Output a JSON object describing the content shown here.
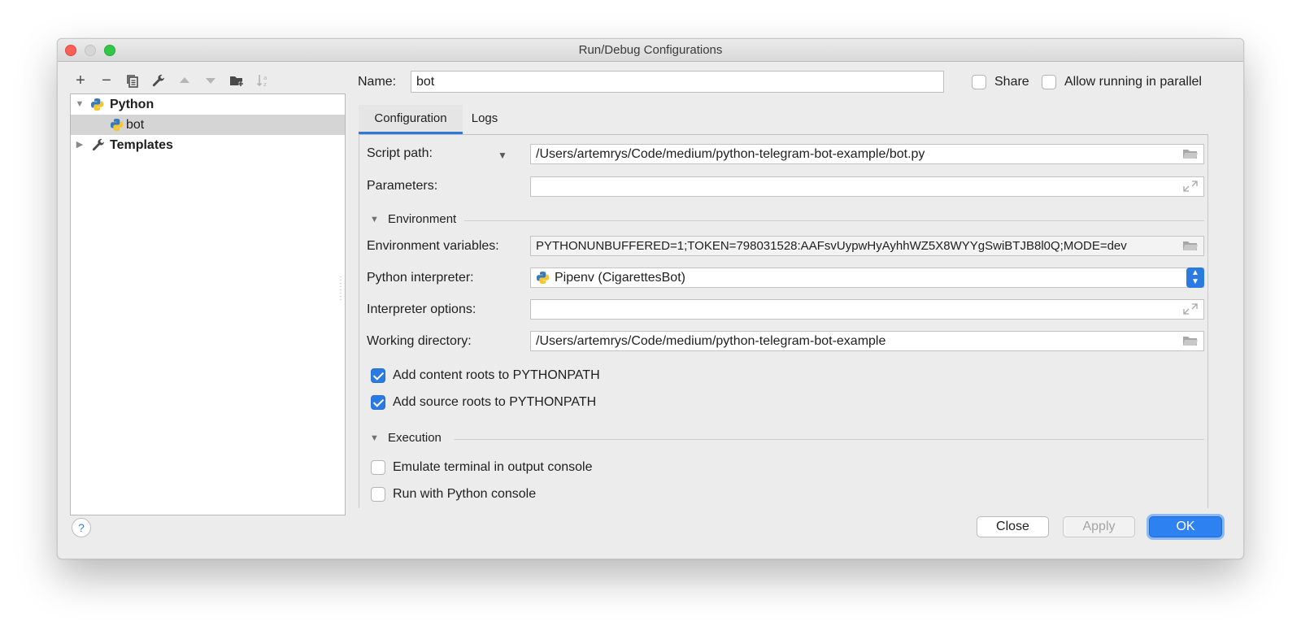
{
  "window": {
    "title": "Run/Debug Configurations"
  },
  "toolbar": {
    "add": "+",
    "remove": "−"
  },
  "tree": {
    "python_label": "Python",
    "bot_label": "bot",
    "templates_label": "Templates"
  },
  "name": {
    "label": "Name:",
    "value": "bot"
  },
  "share": {
    "label": "Share",
    "checked": false
  },
  "parallel": {
    "label": "Allow running in parallel",
    "checked": false
  },
  "tabs": [
    {
      "label": "Configuration",
      "selected": true
    },
    {
      "label": "Logs",
      "selected": false
    }
  ],
  "form": {
    "script_path_label": "Script path:",
    "script_path_value": "/Users/artemrys/Code/medium/python-telegram-bot-example/bot.py",
    "parameters_label": "Parameters:",
    "parameters_value": "",
    "environment_section": "Environment",
    "env_vars_label": "Environment variables:",
    "env_vars_value": "PYTHONUNBUFFERED=1;TOKEN=798031528:AAFsvUypwHyAyhhWZ5X8WYYgSwiBTJB8l0Q;MODE=dev",
    "interpreter_label": "Python interpreter:",
    "interpreter_value": "Pipenv (CigarettesBot)",
    "interpreter_options_label": "Interpreter options:",
    "interpreter_options_value": "",
    "working_dir_label": "Working directory:",
    "working_dir_value": "/Users/artemrys/Code/medium/python-telegram-bot-example",
    "content_roots_label": "Add content roots to PYTHONPATH",
    "content_roots_checked": true,
    "source_roots_label": "Add source roots to PYTHONPATH",
    "source_roots_checked": true,
    "execution_section": "Execution",
    "emulate_terminal_label": "Emulate terminal in output console",
    "emulate_terminal_checked": false,
    "python_console_label": "Run with Python console",
    "python_console_checked": false
  },
  "buttons": {
    "help": "?",
    "close": "Close",
    "apply": "Apply",
    "ok": "OK"
  },
  "colors": {
    "accent": "#2a7ae2",
    "ok_button": "#2d81f0",
    "selection": "#d5d5d5"
  },
  "icons": [
    "add-icon",
    "remove-icon",
    "copy-icon",
    "wrench-icon",
    "move-up-icon",
    "move-down-icon",
    "new-folder-icon",
    "sort-icon",
    "python-icon",
    "folder-icon",
    "expand-icon"
  ]
}
